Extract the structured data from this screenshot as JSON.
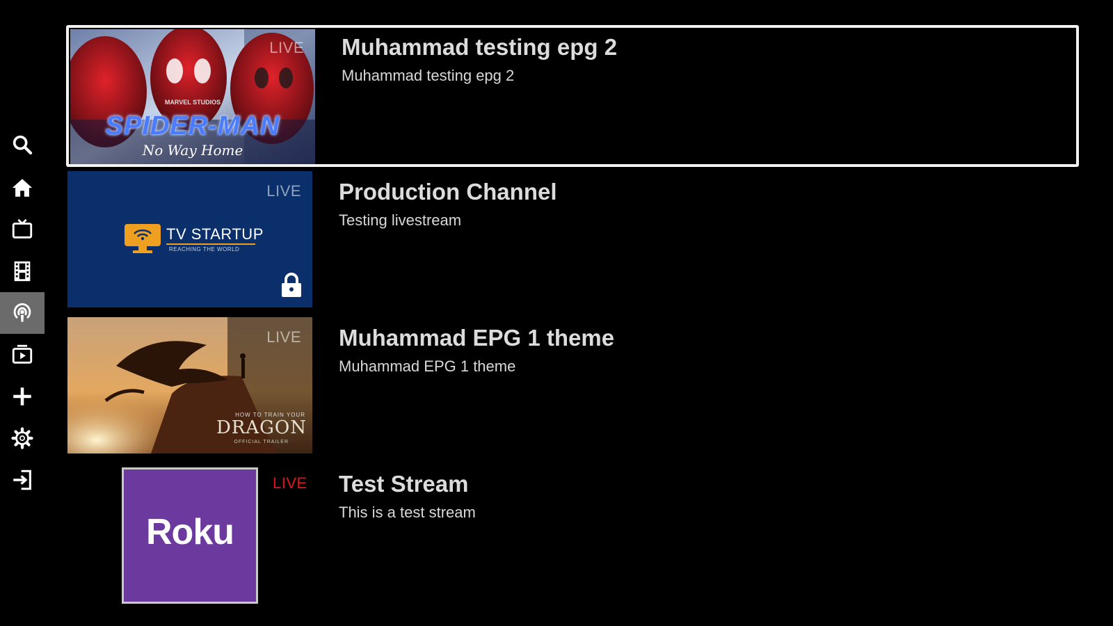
{
  "sidebar": {
    "items": [
      {
        "icon": "search-icon",
        "active": false
      },
      {
        "icon": "home-icon",
        "active": false
      },
      {
        "icon": "tv-icon",
        "active": false
      },
      {
        "icon": "film-icon",
        "active": false
      },
      {
        "icon": "podcast-icon",
        "active": true
      },
      {
        "icon": "video-library-icon",
        "active": false
      },
      {
        "icon": "plus-icon",
        "active": false
      },
      {
        "icon": "gear-icon",
        "active": false
      },
      {
        "icon": "logout-icon",
        "active": false
      }
    ]
  },
  "channels": [
    {
      "title": "Muhammad testing epg 2",
      "subtitle": "Muhammad testing epg 2",
      "live": "LIVE",
      "thumbnail": {
        "title": "SPIDER-MAN",
        "tagline": "No Way Home",
        "studio": "MARVEL STUDIOS"
      }
    },
    {
      "title": "Production Channel",
      "subtitle": "Testing livestream",
      "live": "LIVE",
      "locked": true,
      "thumbnail": {
        "brand": "TV STARTUP",
        "tagline": "REACHING THE WORLD"
      }
    },
    {
      "title": "Muhammad EPG 1 theme",
      "subtitle": "Muhammad EPG 1 theme",
      "live": "LIVE",
      "thumbnail": {
        "title": "DRAGON",
        "pretitle": "HOW TO TRAIN YOUR",
        "tagline": "OFFICIAL TRAILER"
      }
    },
    {
      "title": "Test Stream",
      "subtitle": "This is a test stream",
      "live": "LIVE",
      "thumbnail": {
        "brand": "Roku"
      }
    }
  ],
  "colors": {
    "background": "#000000",
    "focus_border": "#f2f2f2",
    "sidebar_active": "#6b6b6b",
    "live_red": "#e1141b",
    "tvstartup_blue": "#0b2f6b",
    "roku_purple": "#6c3a9e"
  }
}
